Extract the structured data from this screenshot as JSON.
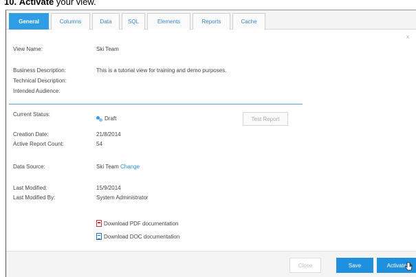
{
  "heading": {
    "number": "10.",
    "action": "Activate",
    "rest": "your view."
  },
  "tabs": [
    {
      "label": "General",
      "active": true
    },
    {
      "label": "Columns"
    },
    {
      "label": "Data"
    },
    {
      "label": "SQL"
    },
    {
      "label": "Elements"
    },
    {
      "label": "Reports"
    },
    {
      "label": "Cache"
    }
  ],
  "close_glyph": "x",
  "fields": {
    "view_name_label": "View Name:",
    "view_name": "Ski Team",
    "business_description_label": "Business Description:",
    "business_description": "This is a tutorial view for training and demo purposes.",
    "technical_description_label": "Technical Description:",
    "intended_audience_label": "Intended Audience:",
    "current_status_label": "Current Status:",
    "current_status": "Draft",
    "creation_date_label": "Creation Date:",
    "creation_date": "21/8/2014",
    "active_report_count_label": "Active Report Count:",
    "active_report_count": "54",
    "data_source_label": "Data Source:",
    "data_source": "Ski Team",
    "data_source_change": "Change",
    "last_modified_label": "Last Modified:",
    "last_modified": "15/9/2014",
    "last_modified_by_label": "Last Modified By:",
    "last_modified_by": "System Administrator"
  },
  "test_report_label": "Test Report",
  "downloads": {
    "pdf": "Download PDF documentation",
    "doc": "Download DOC documentation"
  },
  "footer": {
    "close": "Close",
    "save": "Save",
    "activate": "Activate"
  },
  "colors": {
    "accent": "#2f9de3",
    "button": "#1e90dd",
    "link": "#2f8ed6",
    "separator": "#4aa3df"
  }
}
